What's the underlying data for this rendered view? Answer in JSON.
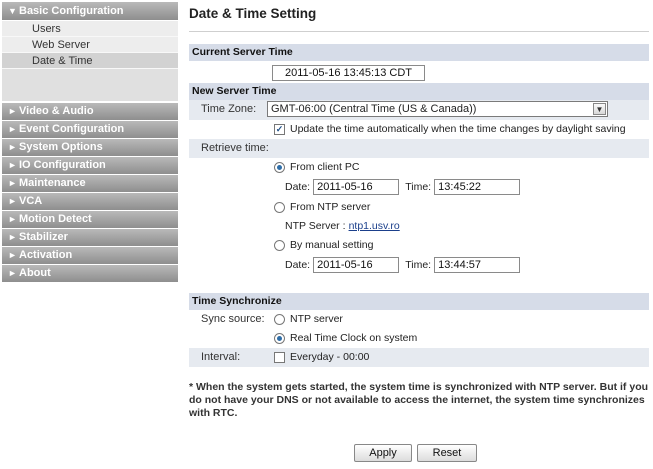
{
  "sidebar": {
    "top_section": "Basic Configuration",
    "sub_items": [
      "Users",
      "Web Server",
      "Date & Time"
    ],
    "sections": [
      "Video & Audio",
      "Event Configuration",
      "System Options",
      "IO Configuration",
      "Maintenance",
      "VCA",
      "Motion Detect",
      "Stabilizer",
      "Activation",
      "About"
    ]
  },
  "page": {
    "title": "Date & Time Setting"
  },
  "current": {
    "heading": "Current Server Time",
    "value": "2011-05-16 13:45:13 CDT"
  },
  "new_time": {
    "heading": "New Server Time",
    "timezone_label": "Time Zone:",
    "timezone_value": "GMT-06:00 (Central Time (US & Canada))",
    "dst_label": "Update the time automatically when the time changes by daylight saving",
    "retrieve_label": "Retrieve time:",
    "from_pc": "From client PC",
    "date_label": "Date:",
    "time_label": "Time:",
    "pc_date": "2011-05-16",
    "pc_time": "13:45:22",
    "from_ntp": "From NTP server",
    "ntp_label": "NTP Server :",
    "ntp_server": "ntp1.usv.ro",
    "manual": "By manual setting",
    "manual_date": "2011-05-16",
    "manual_time": "13:44:57"
  },
  "sync": {
    "heading": "Time Synchronize",
    "source_label": "Sync source:",
    "ntp_option": "NTP server",
    "rtc_option": "Real Time Clock on system",
    "interval_label": "Interval:",
    "interval_option": "Everyday - 00:00"
  },
  "note": "* When the system gets started, the system time is synchronized with NTP server. But if you do not have your DNS or not available to access the internet, the system time synchronizes with RTC.",
  "buttons": {
    "apply": "Apply",
    "reset": "Reset"
  }
}
